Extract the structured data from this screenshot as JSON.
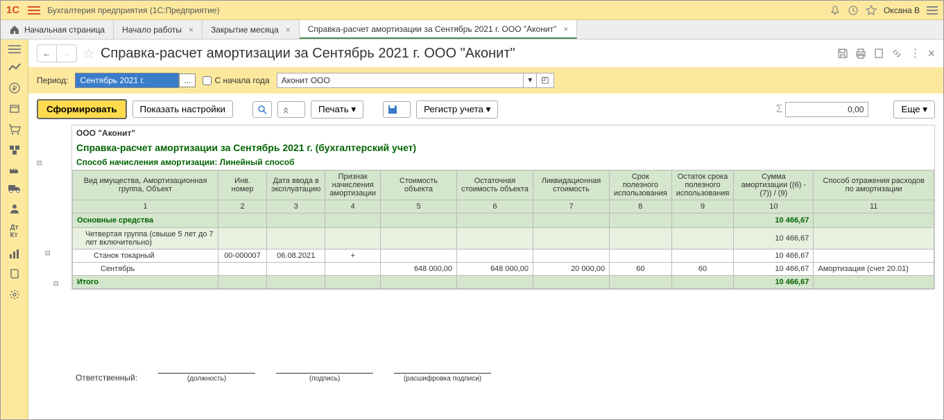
{
  "titlebar": {
    "title": "Бухгалтерия предприятия  (1С:Предприятие)",
    "user": "Оксана В"
  },
  "tabs": {
    "home": "Начальная страница",
    "items": [
      {
        "label": "Начало работы"
      },
      {
        "label": "Закрытие месяца"
      },
      {
        "label": "Справка-расчет амортизации за Сентябрь 2021 г. ООО \"Аконит\"",
        "active": true
      }
    ]
  },
  "page": {
    "title": "Справка-расчет амортизации за Сентябрь 2021 г. ООО \"Аконит\""
  },
  "params": {
    "period_label": "Период:",
    "period_value": "Сентябрь 2021 г.",
    "from_start_label": "С начала года",
    "org": "Аконит ООО"
  },
  "toolbar": {
    "form": "Сформировать",
    "settings": "Показать настройки",
    "print": "Печать",
    "register": "Регистр учета",
    "more": "Еще",
    "sum_value": "0,00"
  },
  "report": {
    "org": "ООО \"Аконит\"",
    "title": "Справка-расчет амортизации за Сентябрь 2021 г. (бухгалтерский учет)",
    "method_label": "Способ начисления амортизации:  Линейный способ",
    "headers": [
      "Вид имущества,\nАмортизационная группа,\nОбъект",
      "Инв. номер",
      "Дата ввода в эксплуатацию",
      "Признак начисления амортизации",
      "Стоимость объекта",
      "Остаточная стоимость объекта",
      "Ликвидационная стоимость",
      "Срок полезного использования",
      "Остаток срока полезного использования",
      "Сумма амортизации ((6) - (7)) / (9)",
      "Способ отражения расходов по амортизации"
    ],
    "col_nums": [
      "1",
      "2",
      "3",
      "4",
      "5",
      "6",
      "7",
      "8",
      "9",
      "10",
      "11"
    ],
    "group": {
      "name": "Основные средства",
      "amort": "10 466,67"
    },
    "subgroup": {
      "name": "Четвертая группа (свыше 5 лет до 7 лет включительно)",
      "amort": "10 466,67"
    },
    "item": {
      "name": "Станок токарный",
      "inv": "00-000007",
      "date": "06.08.2021",
      "flag": "+",
      "amort": "10 466,67"
    },
    "detail": {
      "name": "Сентябрь",
      "cost": "648 000,00",
      "residual": "648 000,00",
      "liquid": "20 000,00",
      "term": "60",
      "term_left": "60",
      "amort": "10 466,67",
      "method": "Амортизация (счет 20.01)"
    },
    "total": {
      "name": "Итого",
      "amort": "10 466,67"
    },
    "signer": {
      "label": "Ответственный:",
      "position": "(должность)",
      "signature": "(подпись)",
      "fullname": "(расшифровка подписи)"
    }
  }
}
